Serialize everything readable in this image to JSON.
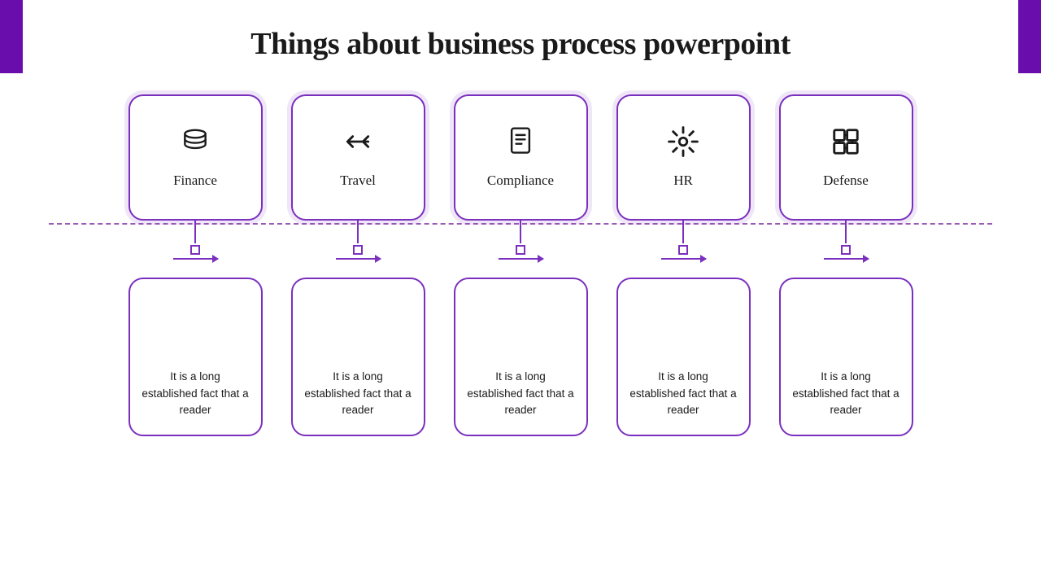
{
  "page": {
    "title": "Things about business process powerpoint"
  },
  "items": [
    {
      "id": "finance",
      "icon": "🪙",
      "label": "Finance",
      "description": "It is a long established fact that a reader"
    },
    {
      "id": "travel",
      "icon": "⇆",
      "label": "Travel",
      "description": "It is a long established fact that a reader"
    },
    {
      "id": "compliance",
      "icon": "📄",
      "label": "Compliance",
      "description": "It is a long established fact that a reader"
    },
    {
      "id": "hr",
      "icon": "✦",
      "label": "HR",
      "description": "It is a long established fact that a reader"
    },
    {
      "id": "defense",
      "icon": "⊞",
      "label": "Defense",
      "description": "It is a long established fact that a reader"
    }
  ],
  "colors": {
    "accent": "#7b2fbe",
    "text": "#1a1a1a"
  }
}
